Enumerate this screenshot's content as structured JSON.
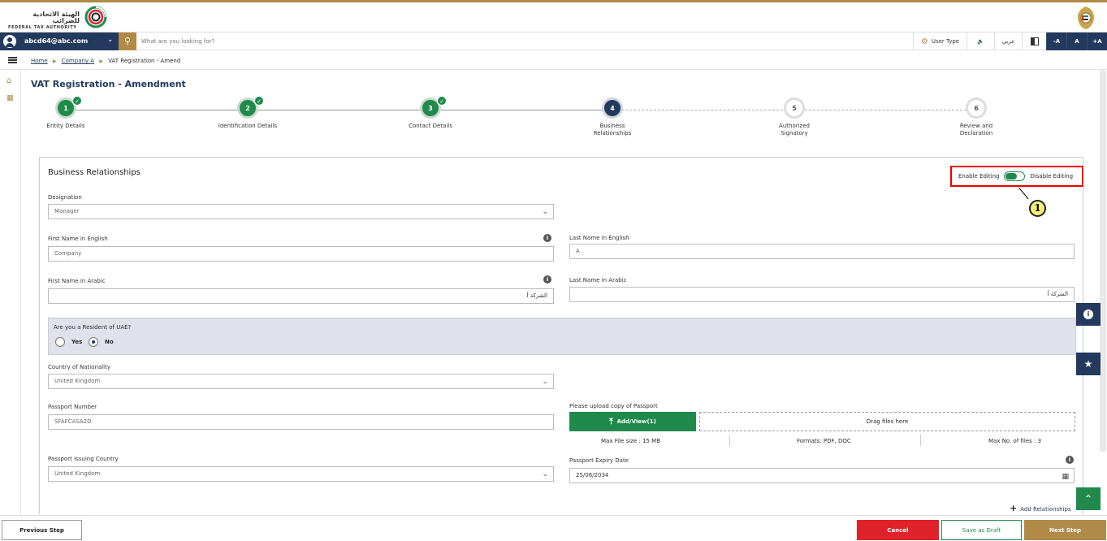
{
  "brand": {
    "name_ar": "الهيئة الاتحادية للضرائب",
    "name_en": "FEDERAL TAX AUTHORITY"
  },
  "navbar": {
    "user_email": "abcd64@abc.com",
    "search_placeholder": "What are you looking for?",
    "user_type_label": "User Type",
    "language_label": "عربي",
    "font_minus": "-A",
    "font_normal": "A",
    "font_plus": "+A"
  },
  "breadcrumb": {
    "home": "Home",
    "company": "Company A",
    "current": "VAT Registration - Amend"
  },
  "page": {
    "title": "VAT Registration - Amendment"
  },
  "stepper": {
    "steps": [
      {
        "number": "1",
        "label": "Entity Details",
        "state": "done"
      },
      {
        "number": "2",
        "label": "Identification Details",
        "state": "done"
      },
      {
        "number": "3",
        "label": "Contact Details",
        "state": "done"
      },
      {
        "number": "4",
        "label": "Business Relationships",
        "state": "current"
      },
      {
        "number": "5",
        "label": "Authorized Signatory",
        "state": "todo"
      },
      {
        "number": "6",
        "label": "Review and Declaration",
        "state": "todo"
      }
    ]
  },
  "form": {
    "section_title": "Business Relationships",
    "enable_editing": "Enable Editing",
    "disable_editing": "Disable Editing",
    "callout_number": "1",
    "designation_label": "Designation",
    "designation_value": "Manager",
    "first_name_en_label": "First Name in English",
    "first_name_en_value": "Company",
    "last_name_en_label": "Last Name in English",
    "last_name_en_value": "A",
    "first_name_ar_label": "First Name in Arabic",
    "first_name_ar_value": "الشركة أ",
    "last_name_ar_label": "Last Name in Arabic",
    "last_name_ar_value": "الشركة أ",
    "resident_question": "Are you a Resident of UAE?",
    "resident_yes": "Yes",
    "resident_no": "No",
    "resident_selected": "No",
    "nationality_label": "Country of Nationality",
    "nationality_value": "United Kingdom",
    "passport_number_label": "Passport Number",
    "passport_number_value": "SFAFCASA2D",
    "upload_label": "Please upload copy of Passport",
    "upload_button": "Add/View(1)",
    "dropzone_text": "Drag files here",
    "max_file_size": "Max File size : 15 MB",
    "formats": "Formats: PDF, DOC",
    "max_files": "Max No. of files : 3",
    "issuing_country_label": "Passport Issuing Country",
    "issuing_country_value": "United Kingdom",
    "expiry_label": "Passport Expiry Date",
    "expiry_value": "25/06/2034",
    "add_relationships": "Add Relationships"
  },
  "footer": {
    "previous": "Previous Step",
    "cancel": "Cancel",
    "save_draft": "Save as Draft",
    "next": "Next Step"
  },
  "colors": {
    "navy": "#233a5e",
    "gold": "#b08a46",
    "green": "#1f8a4c",
    "red": "#e0222b"
  }
}
